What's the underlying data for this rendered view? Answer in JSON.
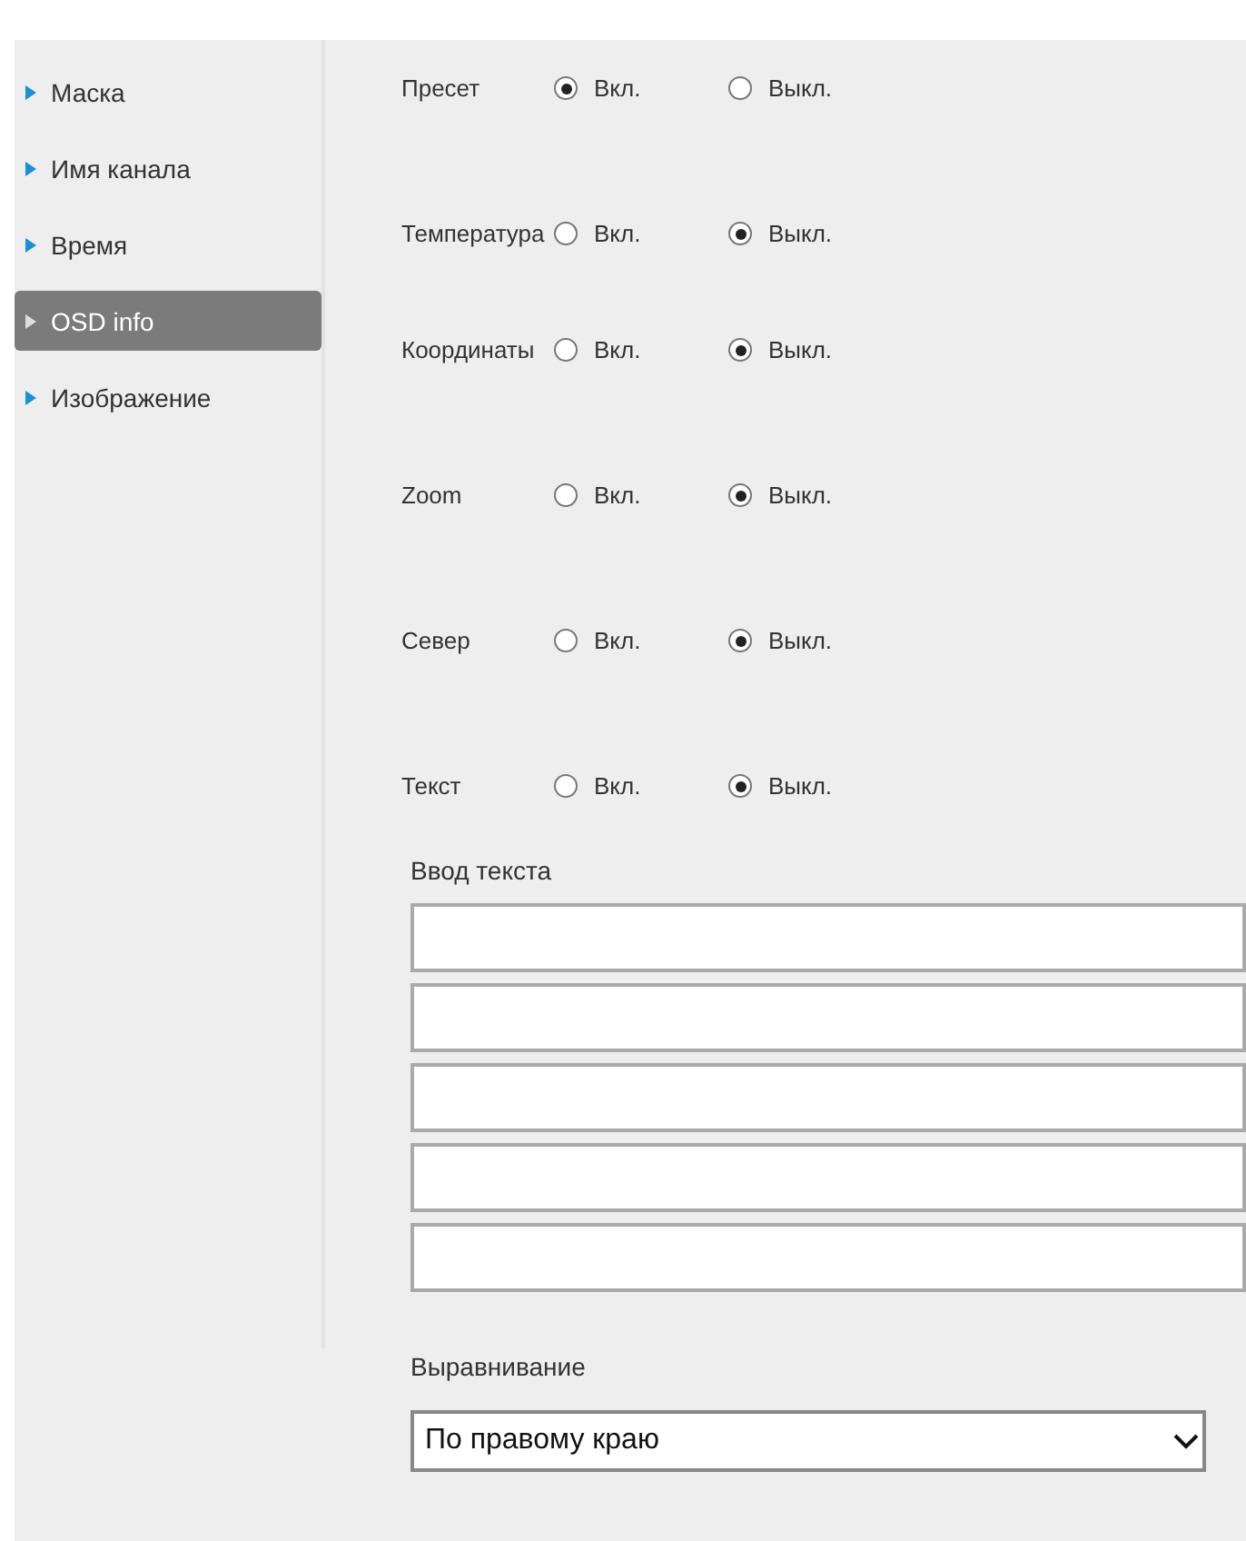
{
  "sidebar": {
    "items": [
      {
        "label": "Маска",
        "selected": false
      },
      {
        "label": "Имя канала",
        "selected": false
      },
      {
        "label": "Время",
        "selected": false
      },
      {
        "label": "OSD info",
        "selected": true
      },
      {
        "label": "Изображение",
        "selected": false
      }
    ]
  },
  "settings": [
    {
      "label": "Пресет",
      "options": [
        {
          "label": "Вкл.",
          "selected": true
        },
        {
          "label": "Выкл.",
          "selected": false
        }
      ]
    },
    {
      "label": "Температура",
      "options": [
        {
          "label": "Вкл.",
          "selected": false
        },
        {
          "label": "Выкл.",
          "selected": true
        }
      ]
    },
    {
      "label": "Координаты",
      "options": [
        {
          "label": "Вкл.",
          "selected": false
        },
        {
          "label": "Выкл.",
          "selected": true
        }
      ]
    },
    {
      "label": "Zoom",
      "options": [
        {
          "label": "Вкл.",
          "selected": false
        },
        {
          "label": "Выкл.",
          "selected": true
        }
      ]
    },
    {
      "label": "Север",
      "options": [
        {
          "label": "Вкл.",
          "selected": false
        },
        {
          "label": "Выкл.",
          "selected": true
        }
      ]
    },
    {
      "label": "Текст",
      "options": [
        {
          "label": "Вкл.",
          "selected": false
        },
        {
          "label": "Выкл.",
          "selected": true
        }
      ]
    }
  ],
  "text_input": {
    "label": "Ввод текста"
  },
  "alignment": {
    "label": "Выравнивание",
    "value": "По правому краю"
  }
}
